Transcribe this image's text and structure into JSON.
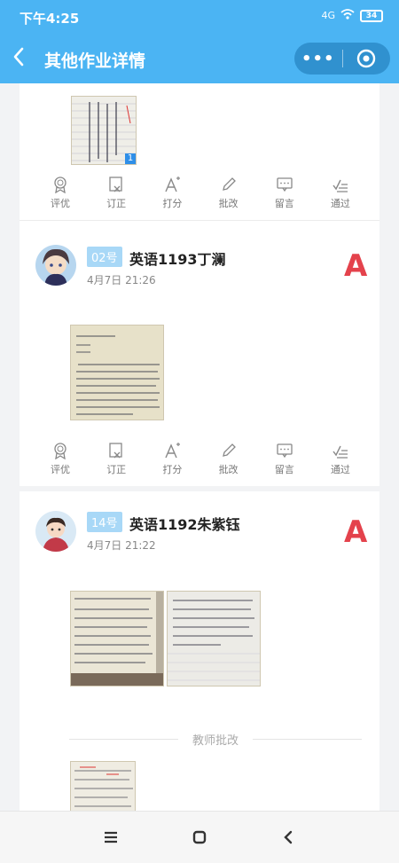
{
  "status_bar": {
    "time": "下午4:25",
    "signal": "4G",
    "battery": "34"
  },
  "nav": {
    "title": "其他作业详情",
    "more_label": "•••"
  },
  "action_labels": [
    "评优",
    "订正",
    "打分",
    "批改",
    "留言",
    "通过"
  ],
  "top_thumb": {
    "count": "1"
  },
  "submissions": [
    {
      "number": "02号",
      "name": "英语1193丁澜",
      "time": "4月7日 21:26",
      "grade": "A"
    },
    {
      "number": "14号",
      "name": "英语1192朱紫钰",
      "time": "4月7日 21:22",
      "grade": "A"
    }
  ],
  "teacher_section": {
    "label": "教师批改"
  },
  "colors": {
    "header": "#4bb4f3",
    "grade": "#e4424c",
    "badge": "#a8d8f7"
  },
  "icons": {
    "back": "chevron-left-icon",
    "more": "more-dots-icon",
    "close": "target-circle-icon",
    "actions": [
      "medal-icon",
      "edit-box-icon",
      "font-plus-icon",
      "pencil-icon",
      "message-icon",
      "check-lines-icon"
    ],
    "bottom": [
      "menu-icon",
      "home-square-icon",
      "back-triangle-icon"
    ]
  }
}
